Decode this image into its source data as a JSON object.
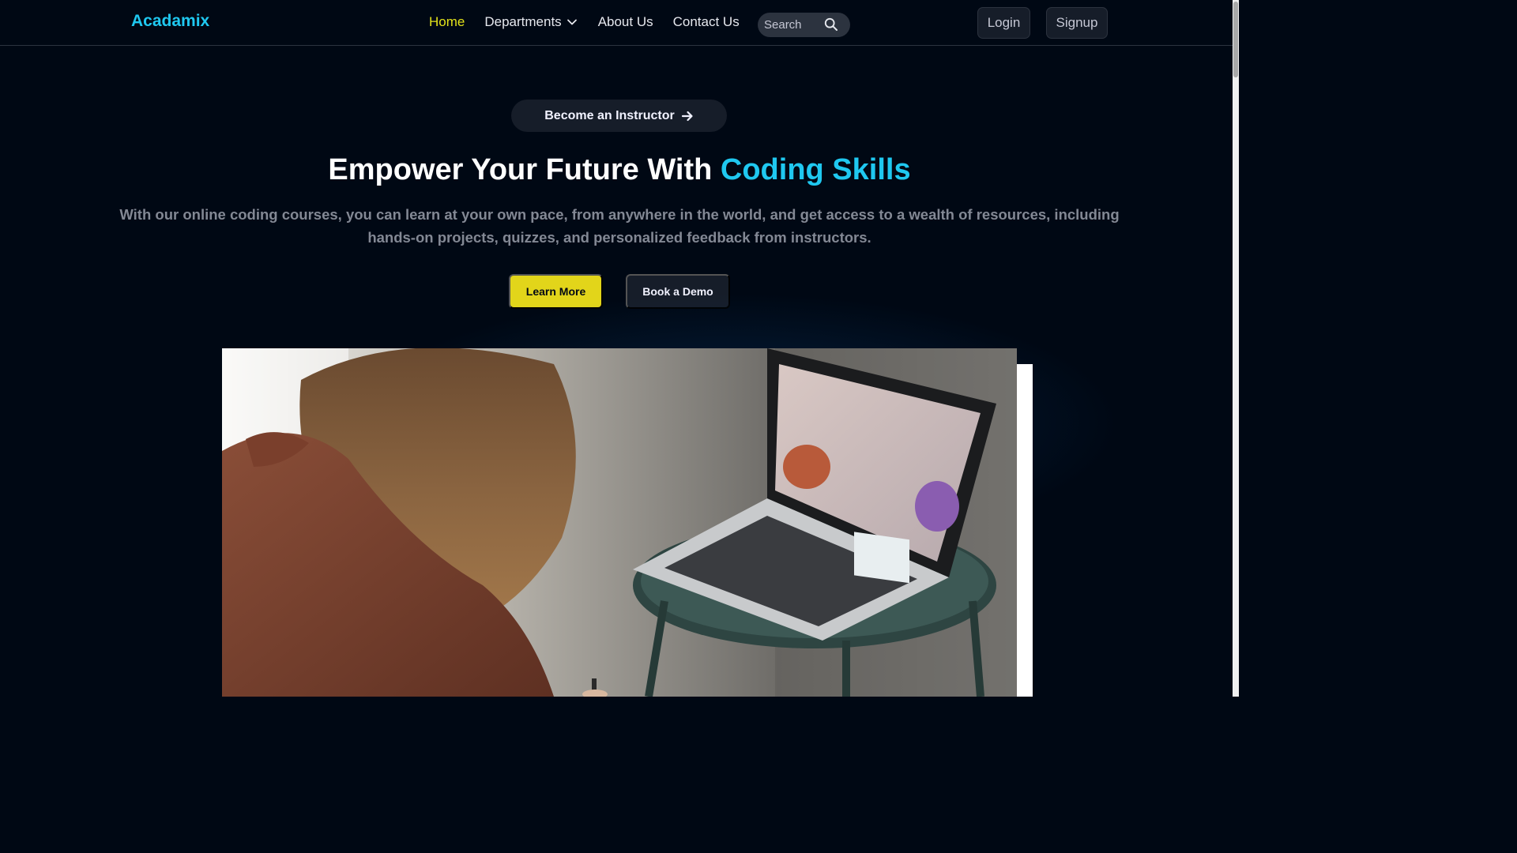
{
  "navbar": {
    "logo": "Acadamix",
    "links": [
      {
        "label": "Home",
        "active": true
      },
      {
        "label": "Departments",
        "dropdown": true
      },
      {
        "label": "About Us"
      },
      {
        "label": "Contact Us"
      }
    ],
    "search_placeholder": "Search",
    "login_label": "Login",
    "signup_label": "Signup"
  },
  "hero": {
    "instructor_label": "Become an Instructor",
    "title_main": "Empower Your Future With ",
    "title_accent": "Coding Skills",
    "subtitle": "With our online coding courses, you can learn at your own pace, from anywhere in the world, and get access to a wealth of resources, including hands-on projects, quizzes, and personalized feedback from instructors.",
    "learn_more_label": "Learn More",
    "book_demo_label": "Book a Demo"
  },
  "colors": {
    "background": "#000814",
    "accent_blue": "#1fc8f0",
    "accent_yellow": "#e2d51a",
    "active_nav": "#e2e21a",
    "surface": "#161d29"
  },
  "icons": [
    "chevron-down-icon",
    "search-icon",
    "arrow-right-icon"
  ]
}
